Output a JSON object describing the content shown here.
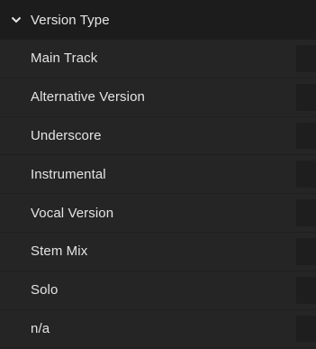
{
  "section": {
    "title": "Version Type",
    "expanded": true,
    "icon": "chevron-down-icon"
  },
  "items": [
    {
      "label": "Main Track"
    },
    {
      "label": "Alternative Version"
    },
    {
      "label": "Underscore"
    },
    {
      "label": "Instrumental"
    },
    {
      "label": "Vocal Version"
    },
    {
      "label": "Stem Mix"
    },
    {
      "label": "Solo"
    },
    {
      "label": "n/a"
    }
  ],
  "colors": {
    "panel_bg": "#252525",
    "header_bg": "#1c1c1c",
    "text": "#e4e4e4",
    "value_cell_bg": "#1e1e1e"
  }
}
